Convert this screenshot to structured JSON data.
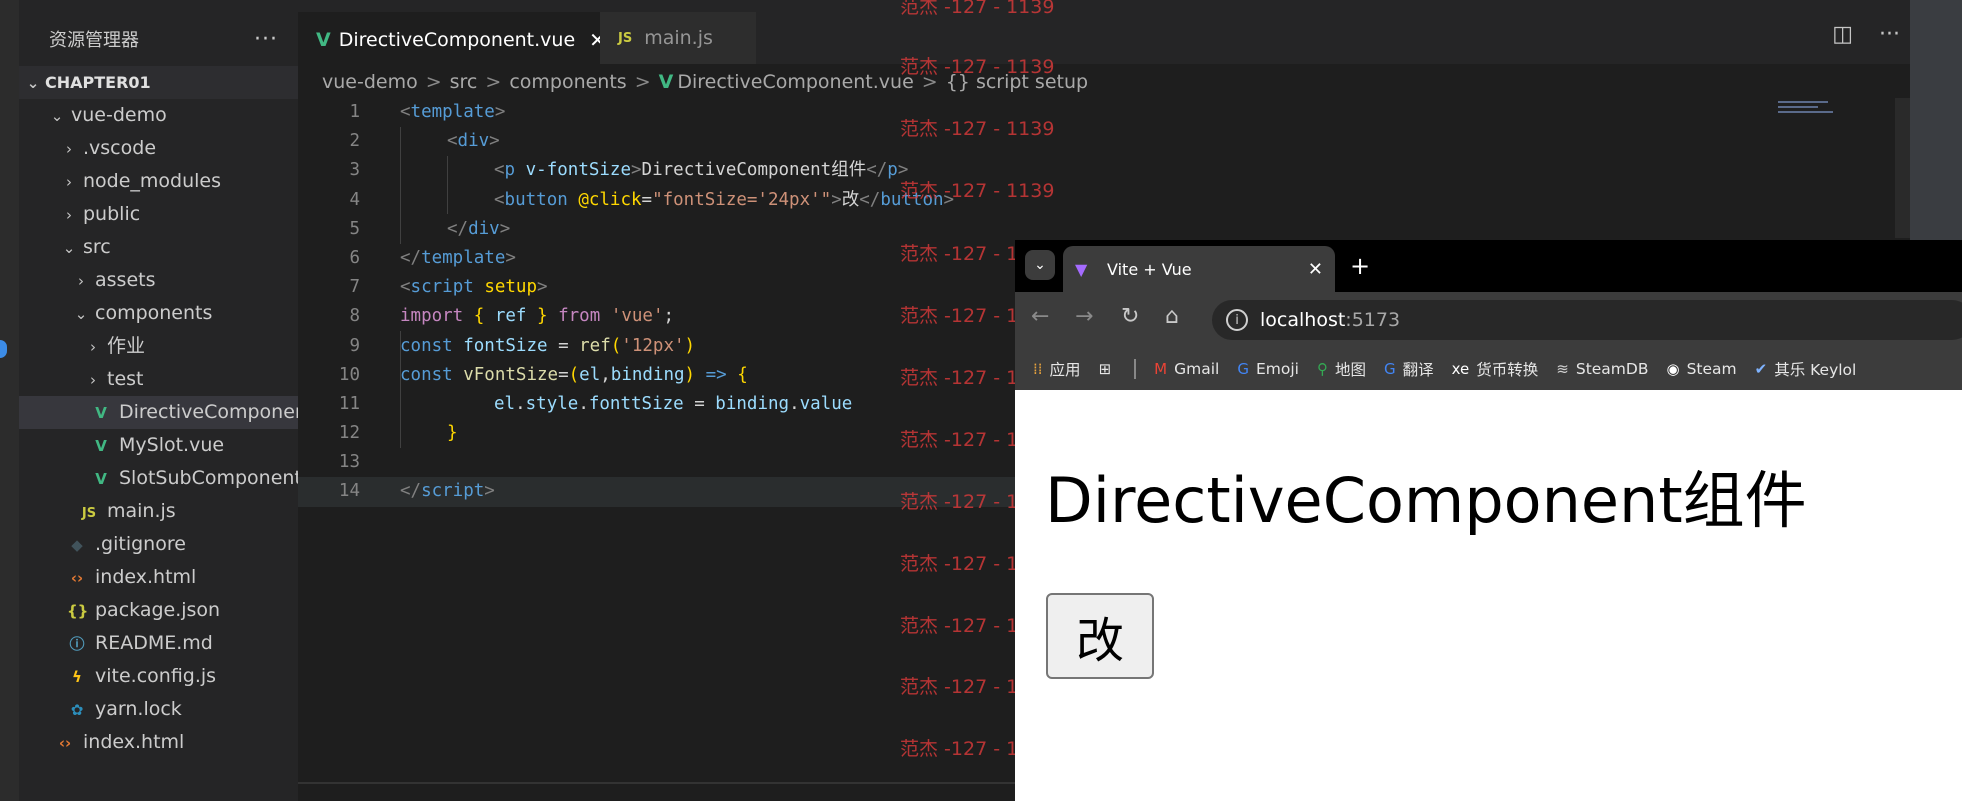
{
  "explorer": {
    "title": "资源管理器",
    "more": "···",
    "section": "CHAPTER01",
    "tree": [
      {
        "label": "vue-demo",
        "kind": "folder-open",
        "depth": 1
      },
      {
        "label": ".vscode",
        "kind": "folder",
        "depth": 2
      },
      {
        "label": "node_modules",
        "kind": "folder",
        "depth": 2
      },
      {
        "label": "public",
        "kind": "folder",
        "depth": 2
      },
      {
        "label": "src",
        "kind": "folder-open",
        "depth": 2
      },
      {
        "label": "assets",
        "kind": "folder",
        "depth": 3
      },
      {
        "label": "components",
        "kind": "folder-open",
        "depth": 3
      },
      {
        "label": "作业",
        "kind": "folder",
        "depth": 4
      },
      {
        "label": "test",
        "kind": "folder",
        "depth": 4
      },
      {
        "label": "DirectiveComponent...",
        "kind": "vue",
        "depth": 4,
        "selected": true
      },
      {
        "label": "MySlot.vue",
        "kind": "vue",
        "depth": 4
      },
      {
        "label": "SlotSubComponent....",
        "kind": "vue",
        "depth": 4
      },
      {
        "label": "main.js",
        "kind": "js",
        "depth": 3
      },
      {
        "label": ".gitignore",
        "kind": "git",
        "depth": 2
      },
      {
        "label": "index.html",
        "kind": "html",
        "depth": 2
      },
      {
        "label": "package.json",
        "kind": "json",
        "depth": 2
      },
      {
        "label": "README.md",
        "kind": "info",
        "depth": 2
      },
      {
        "label": "vite.config.js",
        "kind": "vite",
        "depth": 2
      },
      {
        "label": "yarn.lock",
        "kind": "yarn",
        "depth": 2
      },
      {
        "label": "index.html",
        "kind": "html",
        "depth": 1
      }
    ]
  },
  "tabs": {
    "active": "DirectiveComponent.vue",
    "close": "✕",
    "inactive": "main.js",
    "js_badge": "JS",
    "vue_badge": "V"
  },
  "breadcrumb": {
    "parts": [
      "vue-demo",
      "src",
      "components"
    ],
    "file": "DirectiveComponent.vue",
    "symbol_icon": "{}",
    "symbol": "script setup",
    "sep": ">"
  },
  "code": {
    "line_numbers": [
      "1",
      "2",
      "3",
      "4",
      "5",
      "6",
      "7",
      "8",
      "9",
      "10",
      "11",
      "12",
      "13",
      "14"
    ],
    "l1": [
      "<",
      "template",
      ">"
    ],
    "l2": [
      "<",
      "div",
      ">"
    ],
    "l3": [
      "<",
      "p",
      " ",
      "v-fontSize",
      ">",
      "DirectiveComponent组件",
      "</",
      "p",
      ">"
    ],
    "l4": [
      "<",
      "button",
      " ",
      "@click",
      "=",
      "\"fontSize='24px'\"",
      ">",
      "改",
      "</",
      "button",
      ">"
    ],
    "l5": [
      "</",
      "div",
      ">"
    ],
    "l6": [
      "</",
      "template",
      ">"
    ],
    "l7": [
      "<",
      "script",
      " ",
      "setup",
      ">"
    ],
    "l8": [
      "import",
      " ",
      "{",
      " ",
      "ref",
      " ",
      "}",
      " ",
      "from",
      " ",
      "'vue'",
      ";"
    ],
    "l9": [
      "const",
      " ",
      "fontSize",
      " = ",
      "ref",
      "(",
      "'12px'",
      ")"
    ],
    "l10": [
      "const",
      " ",
      "vFontSize",
      "=",
      "(",
      "el",
      ",",
      "binding",
      ")",
      " => ",
      "{"
    ],
    "l11": [
      "el",
      ".",
      "style",
      ".",
      "fonttSize",
      " = ",
      "binding",
      ".",
      "value"
    ],
    "l12": [
      "}"
    ],
    "l14": [
      "</",
      "script",
      ">"
    ]
  },
  "watermark": {
    "text": "范杰 -127 - 1139"
  },
  "browser": {
    "tab_title": "Vite + Vue",
    "tab_close": "✕",
    "new_tab": "+",
    "tablist_icon": "⌄",
    "back_icon": "←",
    "forward_icon": "→",
    "reload_icon": "↻",
    "home_icon": "⌂",
    "info_icon": "i",
    "url_host": "localhost",
    "url_port": ":5173",
    "bookmarks": [
      {
        "icon": "apps-grid-icon",
        "label": "应用"
      },
      {
        "icon": "tab-groups-icon",
        "label": ""
      },
      {
        "icon": "gmail-icon",
        "label": "Gmail"
      },
      {
        "icon": "google-icon",
        "label": "Emoji"
      },
      {
        "icon": "maps-icon",
        "label": "地图"
      },
      {
        "icon": "translate-icon",
        "label": "翻译"
      },
      {
        "icon": "xe-icon",
        "label": "货币转换"
      },
      {
        "icon": "steamdb-icon",
        "label": "SteamDB"
      },
      {
        "icon": "steam-icon",
        "label": "Steam"
      },
      {
        "icon": "keylol-icon",
        "label": "其乐 Keylol"
      }
    ],
    "page": {
      "heading": "DirectiveComponent组件",
      "button": "改"
    }
  },
  "colors": {
    "editor_bg": "#1e1e1e",
    "sidebar_bg": "#252526",
    "accent_vue": "#41b883",
    "watermark": "#e03b3b"
  }
}
